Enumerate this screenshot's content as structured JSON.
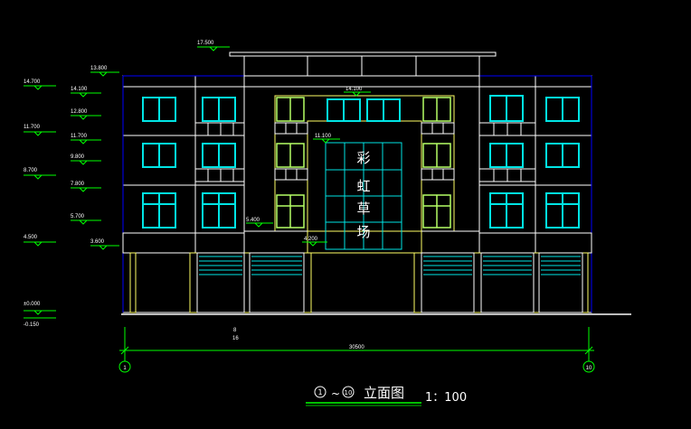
{
  "elevation_marks": {
    "left_outer": [
      "14.700",
      "11.700",
      "8.700",
      "4.500",
      "±0.000",
      "-0.150"
    ],
    "left_inner": [
      "13.800",
      "14.100",
      "12.800",
      "11.700",
      "9.800",
      "7.800",
      "5.700",
      "3.600"
    ],
    "top": [
      "17.500"
    ],
    "center": [
      "14.100",
      "11.100",
      "5.400",
      "4.200"
    ]
  },
  "dimensions": {
    "partial_top": "8",
    "partial_bottom": "16",
    "total": "30500"
  },
  "axis_labels": {
    "start": "1",
    "end": "10"
  },
  "signage": {
    "chars": [
      "彩",
      "虹",
      "草",
      "场"
    ]
  },
  "title": {
    "start": "1",
    "tilde": "~",
    "end": "10",
    "name": "立面图",
    "scale": "1：100"
  },
  "colors": {
    "background": "#000000",
    "outline": "#ffffff",
    "column": "#ffff66",
    "window": "#00e5e5",
    "dimension": "#00ff00",
    "border": "#0000ff",
    "ground": "#bdbdbd"
  }
}
